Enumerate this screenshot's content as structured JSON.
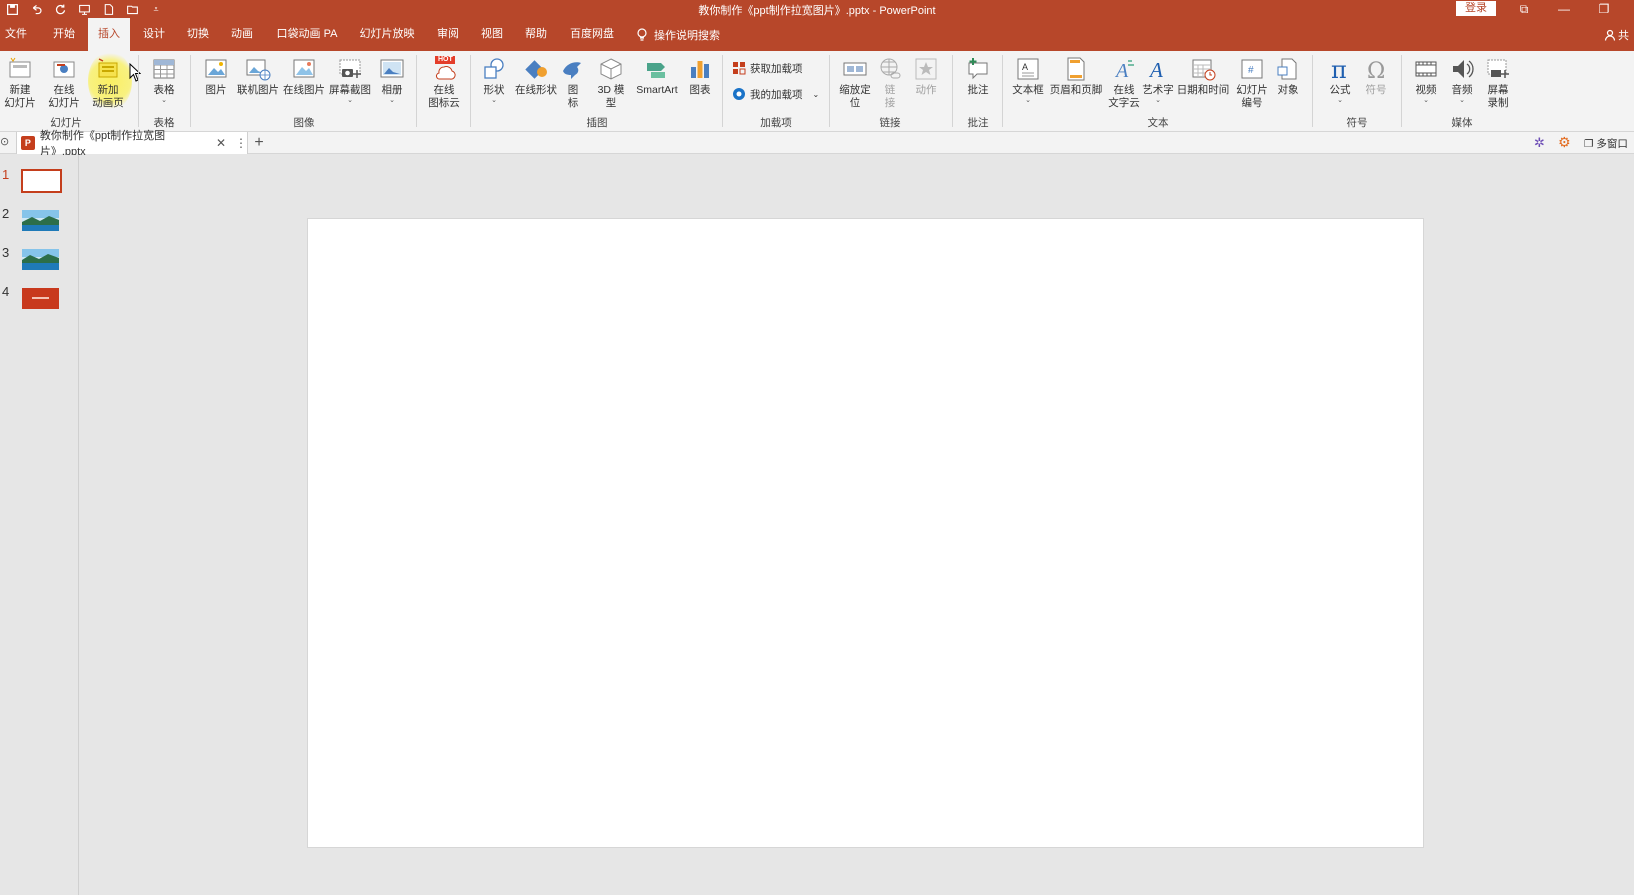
{
  "titlebar": {
    "title": "教你制作《ppt制作拉宽图片》.pptx  -  PowerPoint",
    "login": "登录",
    "controls": [
      "⧉",
      "—",
      "❐"
    ]
  },
  "tabs": [
    {
      "label": "文件"
    },
    {
      "label": "开始"
    },
    {
      "label": "插入"
    },
    {
      "label": "设计"
    },
    {
      "label": "切换"
    },
    {
      "label": "动画"
    },
    {
      "label": "口袋动画 PA"
    },
    {
      "label": "幻灯片放映"
    },
    {
      "label": "审阅"
    },
    {
      "label": "视图"
    },
    {
      "label": "帮助"
    },
    {
      "label": "百度网盘"
    }
  ],
  "tellme": "操作说明搜索",
  "share": "共",
  "ribbon": {
    "slides": {
      "new_slide": "新建\n幻灯片",
      "online_slide": "在线\n幻灯片",
      "anim_page": "新加\n动画页",
      "group": "幻灯片"
    },
    "tables": {
      "table": "表格",
      "group": "表格"
    },
    "images": {
      "picture": "图片",
      "online_pic": "联机图片",
      "online_img": "在线图片",
      "screenshot": "屏幕截图",
      "album": "相册",
      "group": "图像"
    },
    "icons_cloud": {
      "label": "在线\n图标云",
      "hot": "HOT"
    },
    "illustrations": {
      "shapes": "形状",
      "online_shapes": "在线形状",
      "icons": "图\n标",
      "model3d": "3D 模\n型",
      "smartart": "SmartArt",
      "chart": "图表",
      "group": "插图"
    },
    "addins": {
      "get": "获取加载项",
      "mine": "我的加载项",
      "group": "加载项"
    },
    "links": {
      "zoom": "缩放定\n位",
      "link": "链\n接",
      "action": "动作",
      "group": "链接"
    },
    "comments": {
      "comment": "批注",
      "group": "批注"
    },
    "text": {
      "textbox": "文本框",
      "header_footer": "页眉和页脚",
      "online_font": "在线\n文字云",
      "wordart": "艺术字",
      "datetime": "日期和时间",
      "slide_num": "幻灯片\n编号",
      "object": "对象",
      "group": "文本"
    },
    "symbols": {
      "equation": "公式",
      "symbol": "符号",
      "group": "符号"
    },
    "media": {
      "video": "视频",
      "audio": "音频",
      "screen_rec": "屏幕\n录制",
      "group": "媒体"
    }
  },
  "doc": {
    "tab_label": "教你制作《ppt制作拉宽图片》.pptx",
    "multiwindow": "多窗口"
  },
  "slides": [
    {
      "num": "1"
    },
    {
      "num": "2"
    },
    {
      "num": "3"
    },
    {
      "num": "4"
    }
  ],
  "colors": {
    "accent": "#b7472a",
    "ribbon_bg": "#f3f3f3",
    "workspace": "#e6e6e6"
  }
}
